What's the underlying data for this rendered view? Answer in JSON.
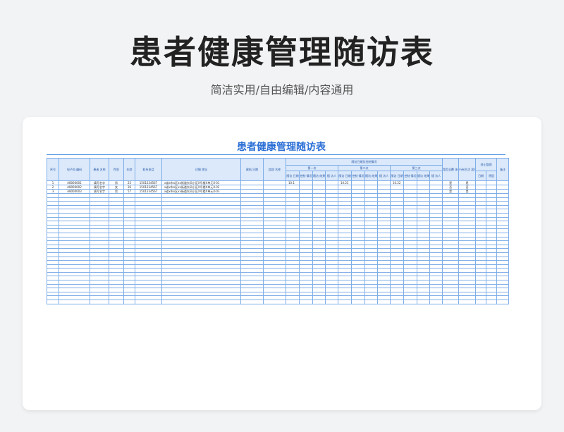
{
  "hero": {
    "title": "患者健康管理随访表",
    "subtitle": "简洁实用/自由编辑/内容通用"
  },
  "sheet": {
    "title": "患者健康管理随访表",
    "headers": {
      "seq": "序号",
      "record_no": "电子档\n编码",
      "name": "患者\n名称",
      "gender": "性别",
      "age": "年龄",
      "phone": "联系电话",
      "address": "详细\n地址",
      "file_date": "建档\n日期",
      "disease": "疾病\n名称",
      "followup_group": "随访日期及控制情况",
      "visit1": "第一次",
      "visit2": "第二次",
      "visit3": "第三次",
      "sub_date": "随访\n日期",
      "sub_control": "控制\n情况",
      "sub_result": "随访\n结果",
      "sub_person": "随\n访人",
      "chronic": "是否全覆\n体检",
      "lifestyle": "行有生活\n居住情况",
      "end_group": "终止管理",
      "end_date": "日期",
      "end_reason": "原因",
      "remark": "备注"
    },
    "rows": [
      {
        "seq": "1",
        "record_no": "A8000001",
        "name": "填写名字",
        "gender": "男",
        "age": "25",
        "phone": "15012345​67",
        "address": "x省x市x区xx街道东风小区X号楼X单元X-01",
        "v1_date": "10.1",
        "v2_date": "10.23",
        "v3_date": "10.22",
        "chronic": "是",
        "lifestyle": "是"
      },
      {
        "seq": "2",
        "record_no": "A8000002",
        "name": "填写名字",
        "gender": "女",
        "age": "36",
        "phone": "15012345​67",
        "address": "x省x市x区xx街道东风小区X号楼X单元X-02",
        "v1_date": "",
        "v2_date": "",
        "v3_date": "",
        "chronic": "否",
        "lifestyle": "否"
      },
      {
        "seq": "3",
        "record_no": "A8000003",
        "name": "填写名字",
        "gender": "男",
        "age": "57",
        "phone": "15012345​67",
        "address": "x省x市x区xx街道东风小区X号楼X单元X-03",
        "v1_date": "",
        "v2_date": "",
        "v3_date": "",
        "chronic": "是",
        "lifestyle": "是"
      }
    ]
  }
}
